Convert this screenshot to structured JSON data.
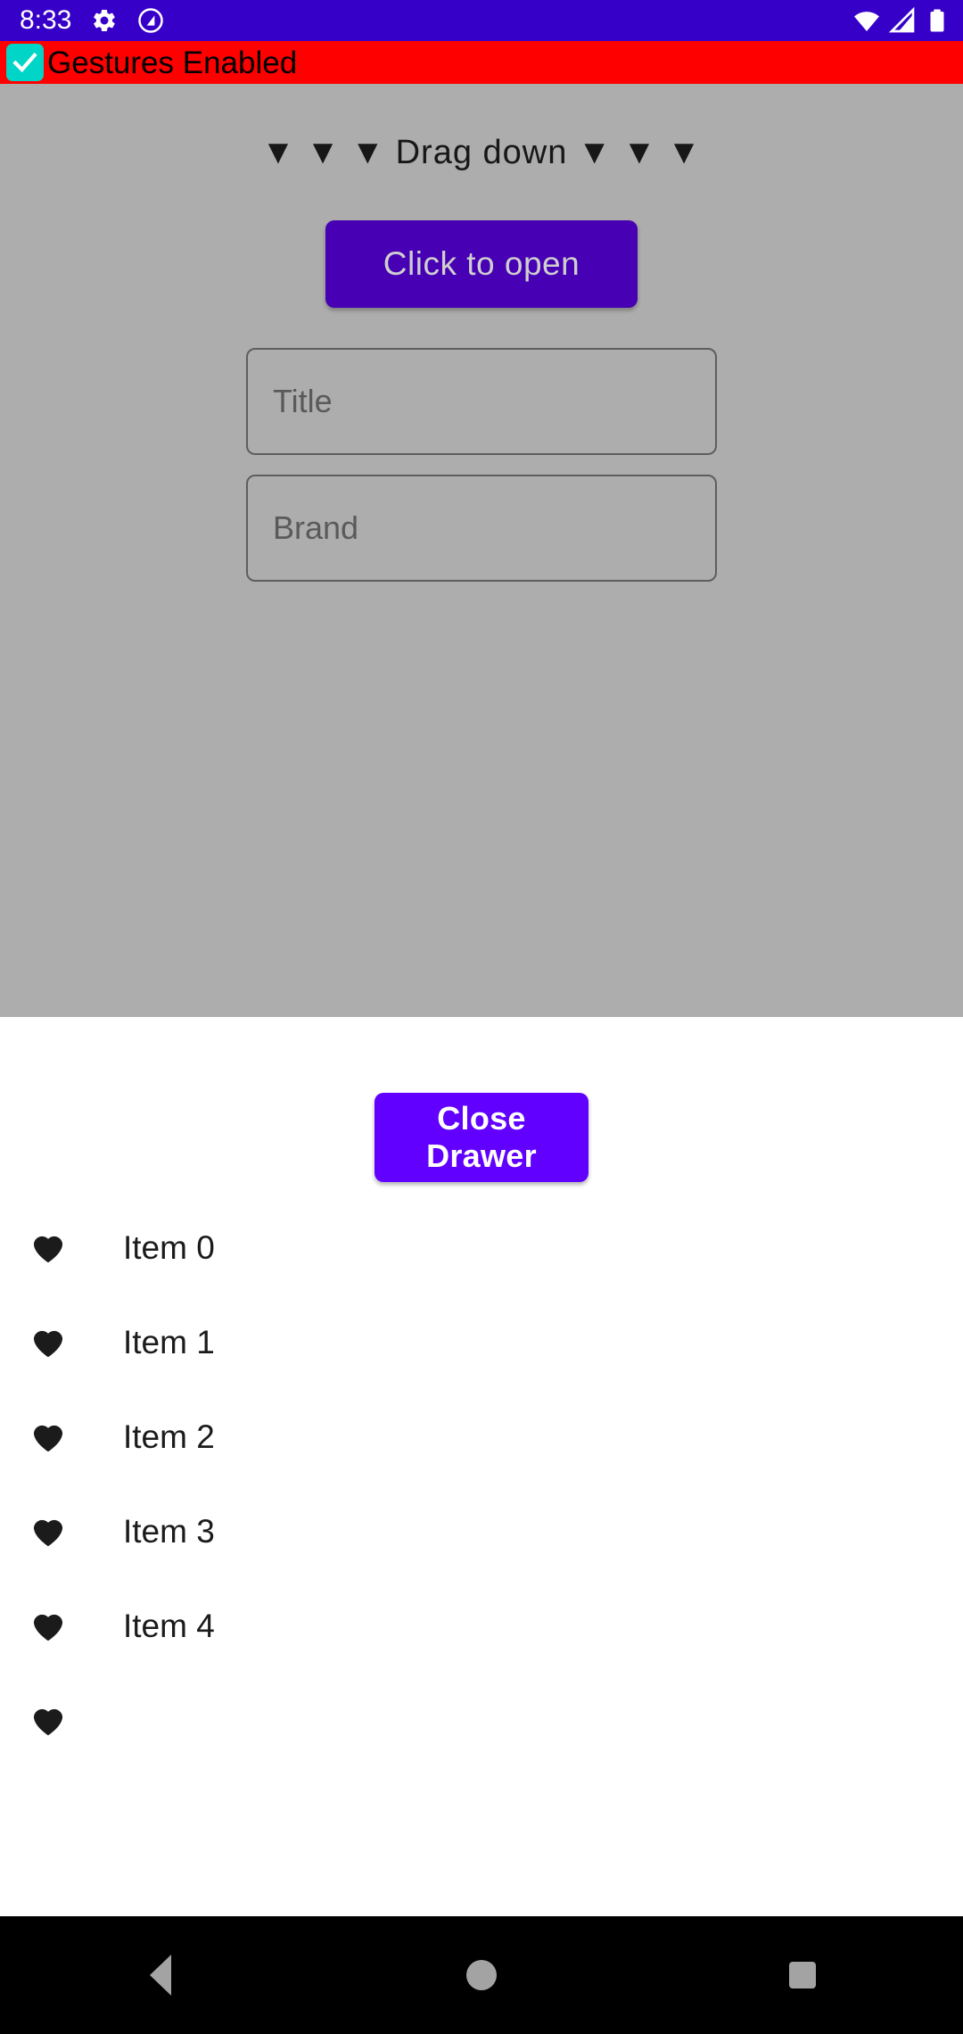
{
  "status_bar": {
    "time": "8:33",
    "icons_left": [
      "gear-icon",
      "play-protect-icon"
    ],
    "icons_right": [
      "wifi-icon",
      "cell-signal-icon",
      "battery-icon"
    ],
    "background_color": "#3700C8"
  },
  "gesture_banner": {
    "checked": true,
    "label": "Gestures Enabled",
    "background_color": "#FF0000",
    "checkbox_color": "#00D5C8"
  },
  "main": {
    "drag_hint": "▼ ▼ ▼ Drag down ▼ ▼ ▼",
    "open_button_label": "Click to open",
    "open_button_color": "#4700B3",
    "fields": [
      {
        "name": "title-field",
        "placeholder": "Title",
        "value": ""
      },
      {
        "name": "brand-field",
        "placeholder": "Brand",
        "value": ""
      }
    ]
  },
  "drawer": {
    "close_button_label": "Close Drawer",
    "close_button_color": "#6200FF",
    "items": [
      {
        "icon": "heart-icon",
        "label": "Item 0"
      },
      {
        "icon": "heart-icon",
        "label": "Item 1"
      },
      {
        "icon": "heart-icon",
        "label": "Item 2"
      },
      {
        "icon": "heart-icon",
        "label": "Item 3"
      },
      {
        "icon": "heart-icon",
        "label": "Item 4"
      },
      {
        "icon": "heart-icon",
        "label": ""
      }
    ]
  },
  "nav_bar": {
    "back_label": "Back",
    "home_label": "Home",
    "recents_label": "Recents",
    "background_color": "#000000"
  }
}
